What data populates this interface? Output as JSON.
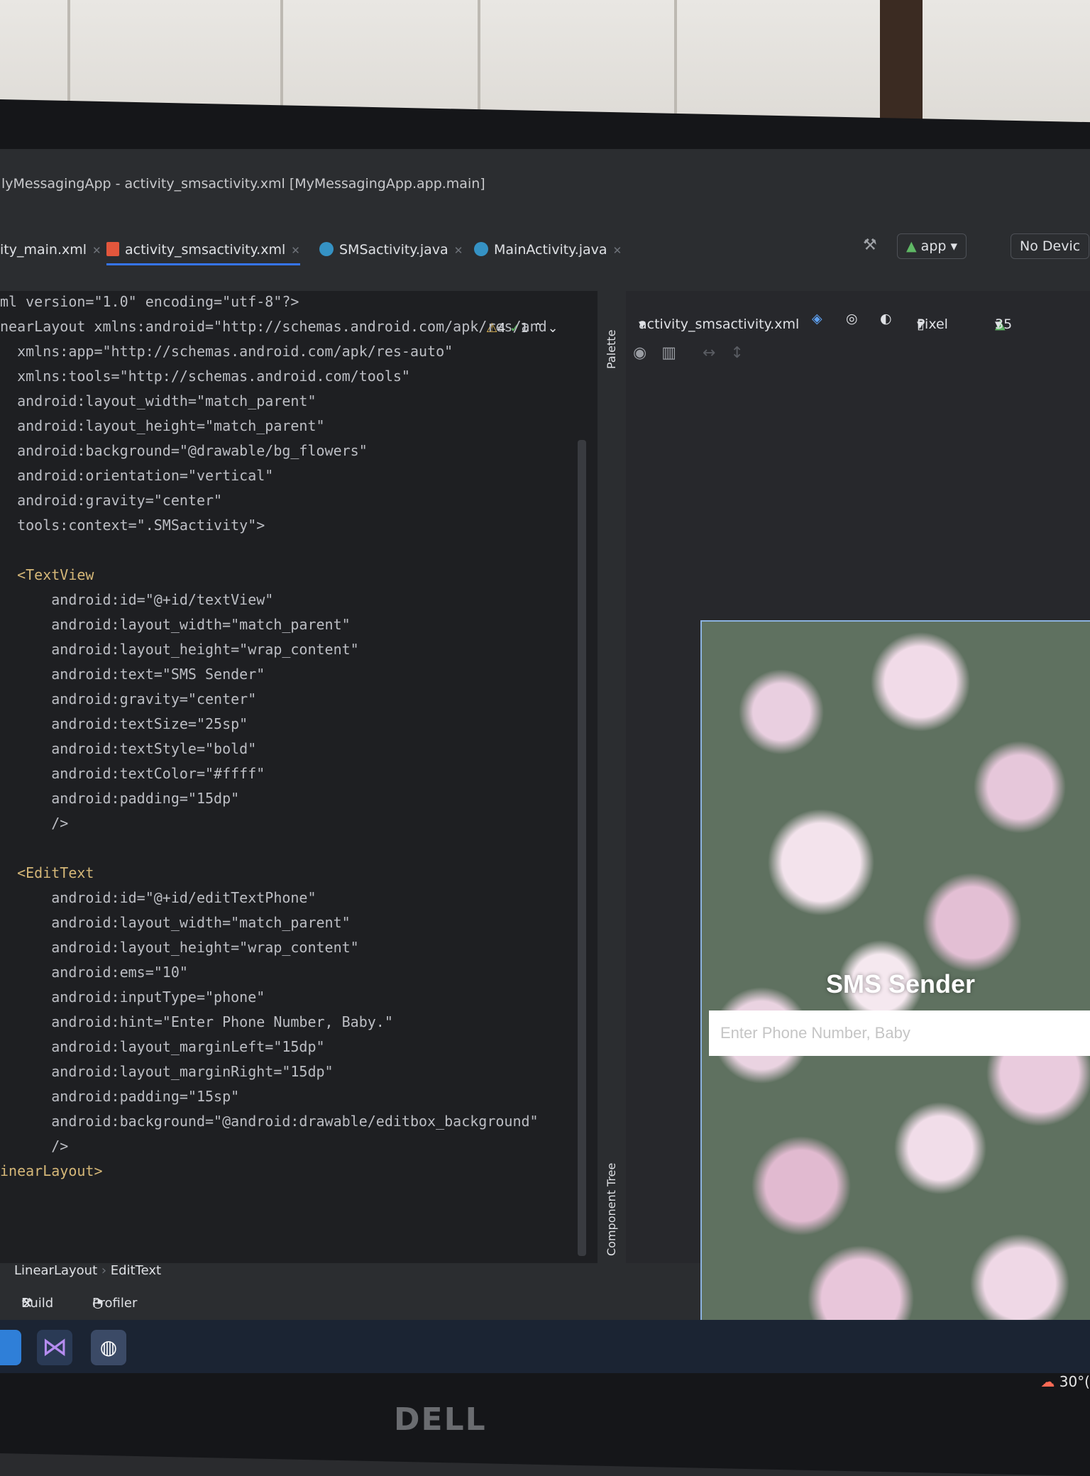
{
  "window": {
    "title": "lyMessagingApp - activity_smsactivity.xml [MyMessagingApp.app.main]"
  },
  "tabs": [
    {
      "label": "ity_main.xml"
    },
    {
      "label": "activity_smsactivity.xml"
    },
    {
      "label": "SMSactivity.java"
    },
    {
      "label": "MainActivity.java"
    }
  ],
  "toolbar": {
    "run_config": "app",
    "device": "No Devic"
  },
  "editor": {
    "warnings": "4",
    "checks": "1",
    "lines": [
      "ml version=\"1.0\" encoding=\"utf-8\"?>",
      "nearLayout xmlns:android=\"http://schemas.android.com/apk/res/and",
      "  xmlns:app=\"http://schemas.android.com/apk/res-auto\"",
      "  xmlns:tools=\"http://schemas.android.com/tools\"",
      "  android:layout_width=\"match_parent\"",
      "  android:layout_height=\"match_parent\"",
      "  android:background=\"@drawable/bg_flowers\"",
      "  android:orientation=\"vertical\"",
      "  android:gravity=\"center\"",
      "  tools:context=\".SMSactivity\">",
      "",
      "  <TextView",
      "      android:id=\"@+id/textView\"",
      "      android:layout_width=\"match_parent\"",
      "      android:layout_height=\"wrap_content\"",
      "      android:text=\"SMS Sender\"",
      "      android:gravity=\"center\"",
      "      android:textSize=\"25sp\"",
      "      android:textStyle=\"bold\"",
      "      android:textColor=\"#ffff\"",
      "      android:padding=\"15dp\"",
      "      />",
      "",
      "  <EditText",
      "      android:id=\"@+id/editTextPhone\"",
      "      android:layout_width=\"match_parent\"",
      "      android:layout_height=\"wrap_content\"",
      "      android:ems=\"10\"",
      "      android:inputType=\"phone\"",
      "      android:hint=\"Enter Phone Number, Baby.\"",
      "      android:layout_marginLeft=\"15dp\"",
      "      android:layout_marginRight=\"15dp\"",
      "      android:padding=\"15sp\"",
      "      android:background=\"@android:drawable/editbox_background\"",
      "      />",
      "inearLayout>"
    ]
  },
  "side_panels": {
    "palette": "Palette",
    "component_tree": "Component Tree"
  },
  "design": {
    "file": "activity_smsactivity.xml",
    "device": "Pixel",
    "api": "35"
  },
  "preview": {
    "title": "SMS Sender",
    "hint": "Enter Phone Number, Baby"
  },
  "breadcrumb": [
    "LinearLayout",
    "EditText"
  ],
  "bottom_tools": [
    "Build",
    "Profiler"
  ],
  "taskbar": {
    "temperature": "30°("
  },
  "monitor": {
    "brand": "DELL"
  }
}
